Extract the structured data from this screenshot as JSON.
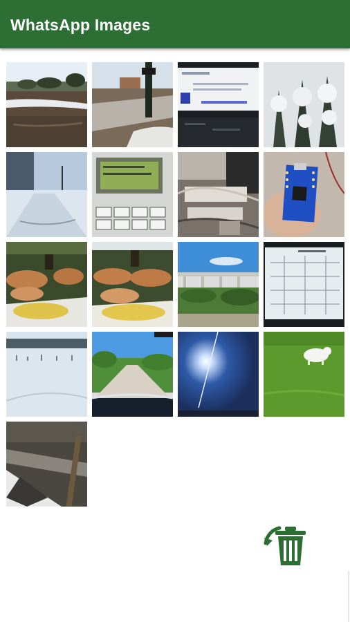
{
  "appbar": {
    "title": "WhatsApp Images",
    "color": "#2c6e33"
  },
  "thumbnails": [
    {
      "subject": "snowy-park-path"
    },
    {
      "subject": "snowy-road-pole"
    },
    {
      "subject": "computer-screen"
    },
    {
      "subject": "snow-covered-trees"
    },
    {
      "subject": "snowy-street"
    },
    {
      "subject": "lcd-device-keypad"
    },
    {
      "subject": "wiring-electronics"
    },
    {
      "subject": "arduino-nano-board"
    },
    {
      "subject": "dogs-lying-in-shade-1"
    },
    {
      "subject": "dogs-lying-in-shade-2"
    },
    {
      "subject": "bridge-landscape"
    },
    {
      "subject": "data-sheet-paper"
    },
    {
      "subject": "snow-field"
    },
    {
      "subject": "country-road"
    },
    {
      "subject": "sun-in-sky"
    },
    {
      "subject": "dog-on-grass"
    },
    {
      "subject": "ditch-with-snow"
    }
  ],
  "delete_action": {
    "icon": "trash-icon",
    "color": "#2c6e33"
  }
}
